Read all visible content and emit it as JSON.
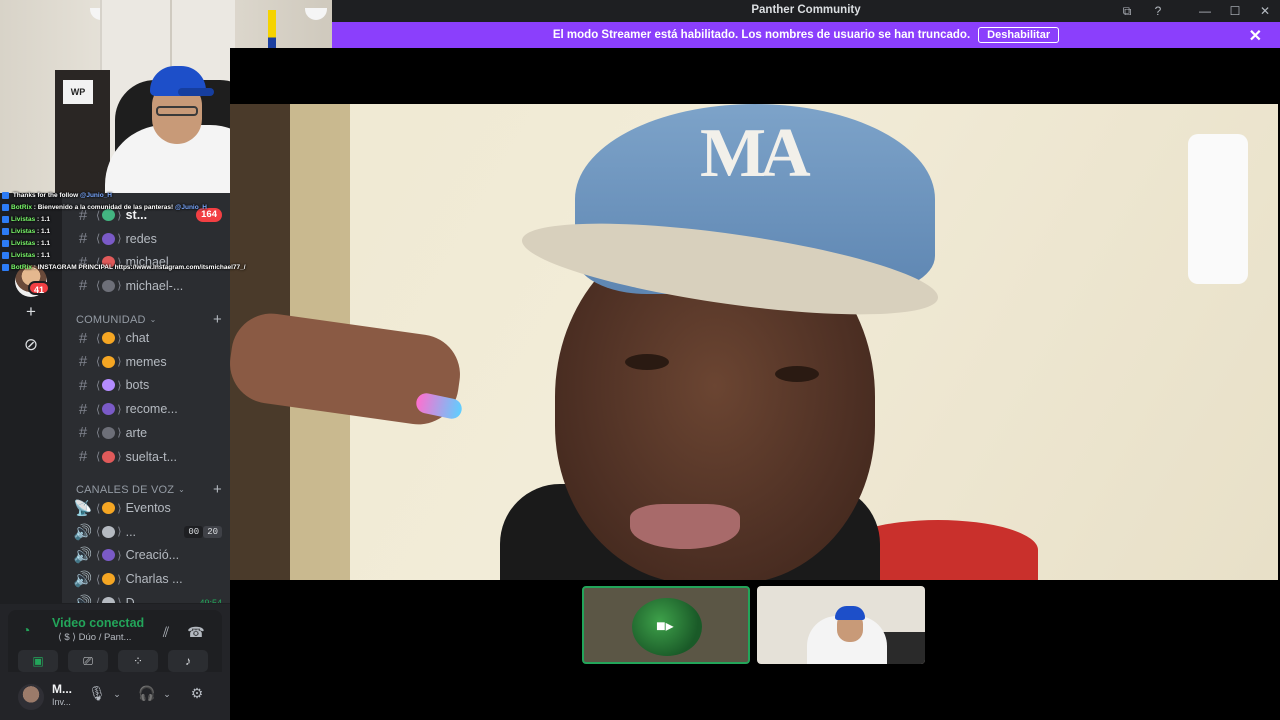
{
  "window": {
    "title": "Panther Community"
  },
  "streamer_mode": {
    "message": "El modo Streamer está habilitado. Los nombres de usuario se han truncado.",
    "disable_label": "Deshabilitar",
    "close_glyph": "✕"
  },
  "chat_overlay": [
    {
      "user": "",
      "text": "Thanks for the follow",
      "mention": "@Junio_H"
    },
    {
      "user": "BotRix",
      "text": ": Bienvenido a la comunidad de las panteras!",
      "mention": "@Junio_H"
    },
    {
      "user": "Livistas",
      "text": ": 1.1",
      "mention": ""
    },
    {
      "user": "Livistas",
      "text": ": 1.1",
      "mention": ""
    },
    {
      "user": "Livistas",
      "text": ": 1.1",
      "mention": ""
    },
    {
      "user": "Livistas",
      "text": ": 1.1",
      "mention": ""
    },
    {
      "user": "BotRix",
      "text": ": INSTAGRAM PRINCIPAL https://www.instagram.com/itsmichael77_/",
      "mention": ""
    }
  ],
  "server_rail": {
    "badge_count": "41",
    "add_glyph": "+",
    "discover_glyph": "⊘"
  },
  "channels_top": [
    {
      "name": "st...",
      "count": "164",
      "bright": true,
      "emoji_color": "#43b581"
    },
    {
      "name": "redes",
      "count": "",
      "bright": false,
      "emoji_color": "#7a5ac7"
    },
    {
      "name": "michael",
      "count": "",
      "bright": false,
      "emoji_color": "#e05a5a"
    },
    {
      "name": "michael-...",
      "count": "",
      "bright": false,
      "emoji_color": "#6d6f78"
    }
  ],
  "categories": {
    "comunidad": "COMUNIDAD",
    "voz": "CANALES DE VOZ"
  },
  "channels_comunidad": [
    {
      "name": "chat",
      "emoji_color": "#f5a623"
    },
    {
      "name": "memes",
      "emoji_color": "#f5a623"
    },
    {
      "name": "bots",
      "emoji_color": "#b48cff"
    },
    {
      "name": "recome...",
      "emoji_color": "#7a5ac7"
    },
    {
      "name": "arte",
      "emoji_color": "#6d6f78"
    },
    {
      "name": "suelta-t...",
      "emoji_color": "#e05a5a"
    }
  ],
  "channels_voz": [
    {
      "name": "Eventos",
      "icon": "📡",
      "emoji_color": "#f5a623"
    },
    {
      "name": "...",
      "icon": "🔊",
      "emoji_color": "#b5bac1",
      "vc": [
        "00",
        "20"
      ]
    },
    {
      "name": "Creació...",
      "icon": "🔊",
      "emoji_color": "#7a5ac7"
    },
    {
      "name": "Charlas ...",
      "icon": "🔊",
      "emoji_color": "#f5a623"
    },
    {
      "name": "D...",
      "icon": "🔊",
      "emoji_color": "#b5bac1",
      "timer": "49:54"
    }
  ],
  "voice": {
    "status": "Video conectado",
    "channel": "Dúo / Pant...",
    "emoji": "⟨ $ ⟩"
  },
  "user": {
    "name": "M...",
    "status": "Inv..."
  },
  "colors": {
    "accent": "#8b3ffc",
    "green": "#23a55a",
    "red": "#f23f43",
    "bg_dark": "#1e1f22",
    "bg_channels": "#2b2d31"
  }
}
